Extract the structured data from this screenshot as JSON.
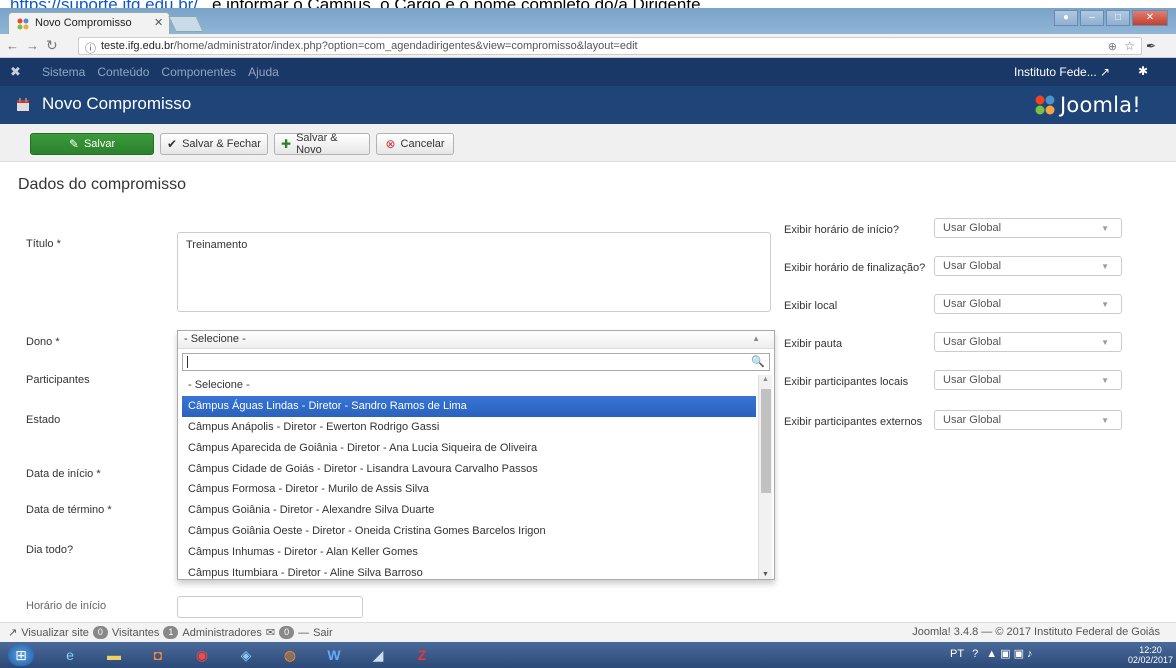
{
  "doc_strip": {
    "link": "https://suporte.ifg.edu.br/",
    "rest": " e informar o Campus, o Cargo e o nome completo do/a Dirigente."
  },
  "browser": {
    "tab_title": "Novo Compromisso",
    "url_host": "teste.ifg.edu.br",
    "url_path": "/home/administrator/index.php?option=com_agendadirigentes&view=compromisso&layout=edit"
  },
  "jnav": {
    "menu": [
      "Sistema",
      "Conteúdo",
      "Componentes",
      "Ajuda"
    ],
    "site": "Instituto Fede... ↗"
  },
  "page": {
    "title": "Novo Compromisso",
    "logo": "Joomla!"
  },
  "toolbar": {
    "save": "Salvar",
    "save_close": "Salvar & Fechar",
    "save_new": "Salvar & Novo",
    "cancel": "Cancelar"
  },
  "form": {
    "legend": "Dados do compromisso",
    "titulo_label": "Título *",
    "titulo_value": "Treinamento",
    "dono_label": "Dono *",
    "participantes_label": "Participantes",
    "estado_label": "Estado",
    "data_inicio_label": "Data de início *",
    "data_termino_label": "Data de término *",
    "dia_todo_label": "Dia todo?",
    "horario_inicio_label": "Horário de início"
  },
  "dropdown": {
    "selected": "- Selecione -",
    "options": [
      "- Selecione -",
      "Câmpus Águas Lindas - Diretor - Sandro Ramos de Lima",
      "Câmpus Anápolis - Diretor - Ewerton Rodrigo Gassi",
      "Câmpus Aparecida de Goiânia - Diretor - Ana Lucia Siqueira de Oliveira",
      "Câmpus Cidade de Goiás - Diretor - Lisandra Lavoura Carvalho Passos",
      "Câmpus Formosa - Diretor - Murilo de Assis Silva",
      "Câmpus Goiânia - Diretor - Alexandre Silva Duarte",
      "Câmpus Goiânia Oeste - Diretor - Oneida Cristina Gomes Barcelos Irigon",
      "Câmpus Inhumas - Diretor - Alan Keller Gomes",
      "Câmpus Itumbiara - Diretor - Aline Silva Barroso"
    ]
  },
  "options_panel": {
    "rows": [
      {
        "label": "Exibir horário de início?",
        "value": "Usar Global"
      },
      {
        "label": "Exibir horário de finalização?",
        "value": "Usar Global"
      },
      {
        "label": "Exibir local",
        "value": "Usar Global"
      },
      {
        "label": "Exibir pauta",
        "value": "Usar Global"
      },
      {
        "label": "Exibir participantes locais",
        "value": "Usar Global"
      },
      {
        "label": "Exibir participantes externos",
        "value": "Usar Global"
      }
    ]
  },
  "status": {
    "view_site": "Visualizar site",
    "visitors_count": "0",
    "visitors": "Visitantes",
    "admins_count": "1",
    "admins": "Administradores",
    "messages_count": "0",
    "logout": "Sair",
    "footer": "Joomla! 3.4.8 — © 2017 Instituto Federal de Goiás"
  },
  "taskbar": {
    "lang": "PT",
    "time": "12:20",
    "date": "02/02/2017"
  }
}
